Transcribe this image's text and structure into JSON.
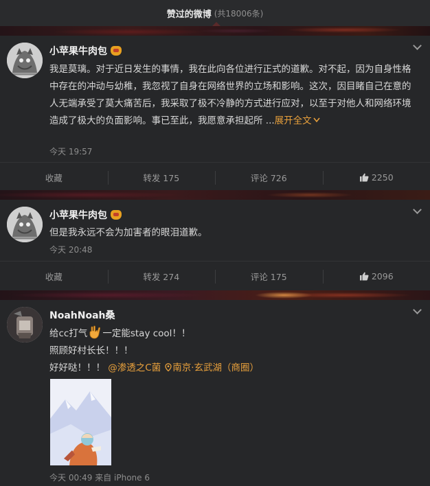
{
  "header": {
    "title": "赞过的微博",
    "count": "(共18006条)"
  },
  "posts": [
    {
      "author": "小苹果牛肉包",
      "text": "我是莫璃。对于近日发生的事情，我在此向各位进行正式的道歉。对不起，因为自身性格中存在的冲动与幼稚，我忽视了自身在网络世界的立场和影响。这次，因目睹自己在意的人无端承受了莫大痛苦后，我采取了极不冷静的方式进行应对，以至于对他人和网络环境造成了极大的负面影响。事已至此，我愿意承担起所 ...",
      "expand_label": "展开全文",
      "time": "今天 19:57",
      "actions": {
        "favorite": "收藏",
        "repost": "转发 175",
        "comment": "评论 726",
        "like": "2250"
      }
    },
    {
      "author": "小苹果牛肉包",
      "text": "但是我永远不会为加害者的眼泪道歉。",
      "time": "今天 20:48",
      "actions": {
        "favorite": "收藏",
        "repost": "转发 274",
        "comment": "评论 175",
        "like": "2096"
      }
    },
    {
      "author": "NoahNoah桑",
      "line1_a": "给cc打气",
      "line1_b": "一定能stay cool！！",
      "line2": "照顾好村长长！！！",
      "line3": "好好哒！！！",
      "mention": "@渗透之C菌",
      "location": "南京·玄武湖（商圈）",
      "time": "今天 00:49 来自 iPhone 6"
    }
  ],
  "colors": {
    "accent": "#e8a03c",
    "background": "#1e1f21",
    "card": "#262729"
  },
  "icons": [
    "chevron-down-icon",
    "vip-crown-icon",
    "thumbs-up-icon",
    "location-pin-icon",
    "rock-hand-emoji"
  ]
}
